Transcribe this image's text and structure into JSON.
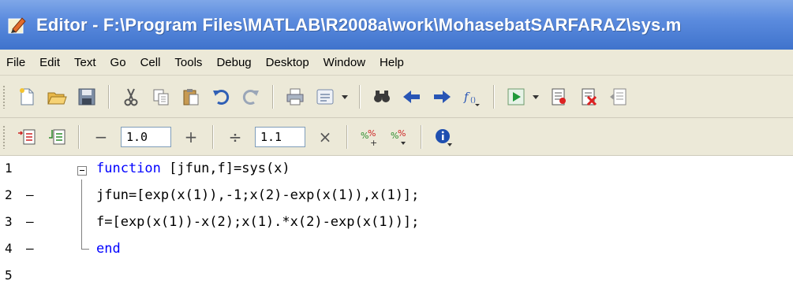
{
  "window": {
    "title": "Editor - F:\\Program Files\\MATLAB\\R2008a\\work\\MohasebatSARFARAZ\\sys.m",
    "icon": "editor-app-icon"
  },
  "menubar": {
    "items": [
      "File",
      "Edit",
      "Text",
      "Go",
      "Cell",
      "Tools",
      "Debug",
      "Desktop",
      "Window",
      "Help"
    ]
  },
  "toolbar": {
    "icons": [
      "new-file-icon",
      "open-folder-icon",
      "save-icon",
      "cut-icon",
      "copy-icon",
      "paste-icon",
      "undo-icon",
      "redo-icon",
      "print-icon",
      "comment-icon",
      "find-icon",
      "back-arrow-icon",
      "forward-arrow-icon",
      "function-icon",
      "run-icon",
      "set-breakpoint-icon",
      "clear-breakpoint-icon",
      "step-icon"
    ]
  },
  "cell_toolbar": {
    "decrement_symbol": "−",
    "decrement_value": "1.0",
    "increment_symbol": "+",
    "divide_symbol": "÷",
    "divide_value": "1.1",
    "multiply_symbol": "×",
    "icons": [
      "insert-cell-icon",
      "evaluate-cell-icon",
      "percent-plus-icon",
      "percent-icon",
      "info-icon"
    ]
  },
  "editor": {
    "lines": [
      {
        "number": "1",
        "bp": "",
        "keyword": "function",
        "rest": " [jfun,f]=sys(x)"
      },
      {
        "number": "2",
        "bp": "–",
        "keyword": "",
        "rest": "jfun=[exp(x(1)),-1;x(2)-exp(x(1)),x(1)];"
      },
      {
        "number": "3",
        "bp": "–",
        "keyword": "",
        "rest": "f=[exp(x(1))-x(2);x(1).*x(2)-exp(x(1))];"
      },
      {
        "number": "4",
        "bp": "–",
        "keyword": "end",
        "rest": ""
      },
      {
        "number": "5",
        "bp": "",
        "keyword": "",
        "rest": ""
      }
    ]
  },
  "colors": {
    "title_bar": "#3f73cc",
    "keyword": "#0000ff",
    "chrome": "#ece9d8"
  }
}
